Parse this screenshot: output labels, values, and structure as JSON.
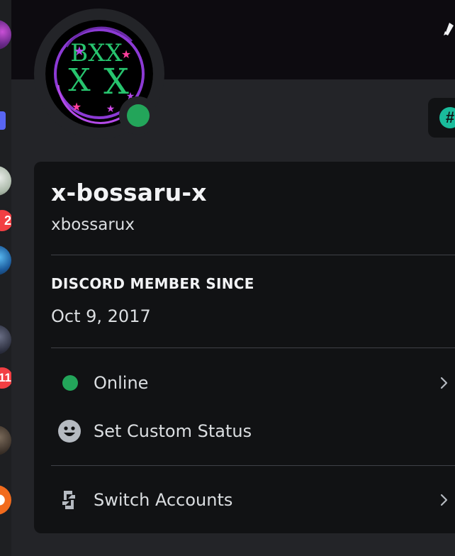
{
  "profile": {
    "display_name": "x-bossaru-x",
    "username": "xbossarux",
    "avatar_monogram": "BXX",
    "status_color": "#23a55a",
    "badge_symbol": "#"
  },
  "member_since": {
    "heading": "DISCORD MEMBER SINCE",
    "date": "Oct 9, 2017"
  },
  "menu": {
    "status_label": "Online",
    "custom_status_label": "Set Custom Status",
    "switch_accounts_label": "Switch Accounts"
  },
  "rail": {
    "badge_counts": [
      "2",
      "11"
    ]
  },
  "colors": {
    "background": "#232428",
    "card": "#111214",
    "banner": "#0d0b10",
    "accent_green": "#23a55a",
    "badge_red": "#f23f43",
    "brand_blurple": "#5865f2"
  },
  "icons": {
    "status": "online-dot-icon",
    "custom_status": "smiley-icon",
    "switch_accounts": "switch-accounts-icon",
    "chevron": "chevron-right-icon",
    "edit": "pencil-icon"
  }
}
